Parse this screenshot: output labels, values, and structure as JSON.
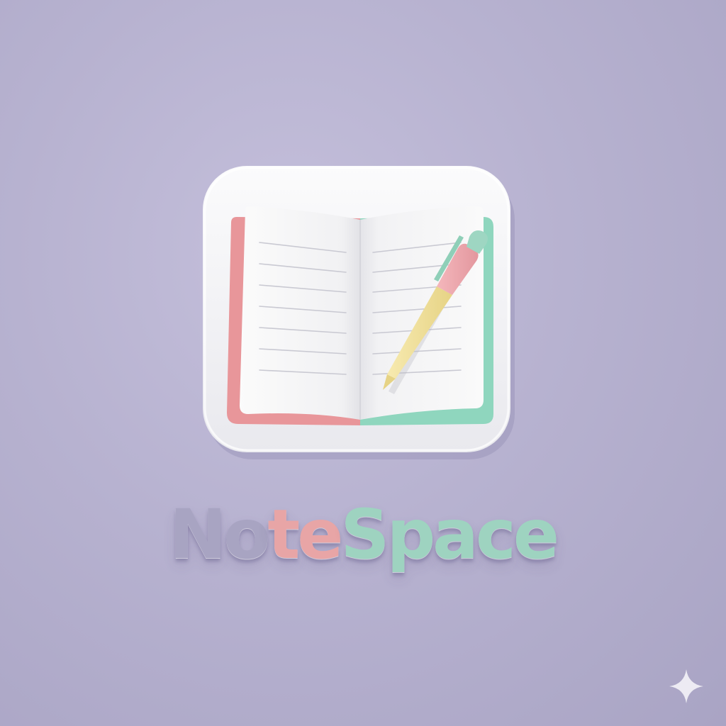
{
  "logo": {
    "name": "NoteSpace",
    "segments": [
      {
        "text": "No",
        "color": "#a8a4c2"
      },
      {
        "text": "te",
        "color": "#e8a5a6"
      },
      {
        "text": "Space",
        "color": "#9ed3c0"
      }
    ]
  },
  "icon": {
    "name": "open-notebook-with-pen-icon",
    "colors": {
      "tile": "#f3f3f5",
      "left_cover": "#e8969a",
      "right_cover": "#8fd6be",
      "page": "#f7f7f8",
      "rule": "#c9c9d2",
      "pen_barrel": "#f1e19d",
      "pen_grip": "#eea8ae",
      "pen_cap": "#9ed6c2"
    }
  },
  "sparkle": {
    "name": "sparkle-icon",
    "color": "#f2f1f6"
  },
  "colors": {
    "background": "#b8b3d1"
  }
}
